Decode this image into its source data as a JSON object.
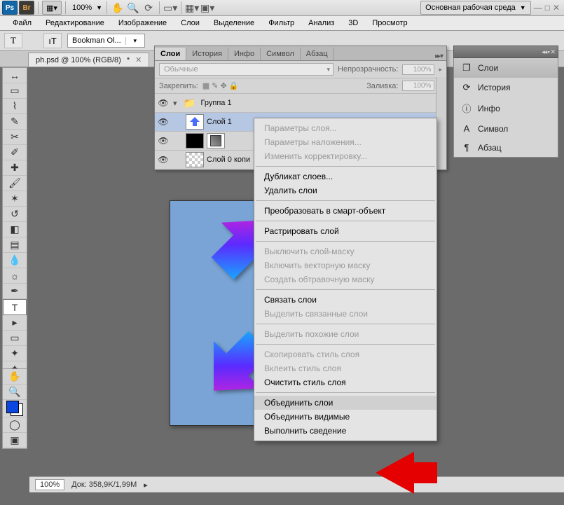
{
  "topbar": {
    "ps": "Ps",
    "br": "Br",
    "zoom": "100%",
    "workspace": "Основная рабочая среда"
  },
  "menubar": [
    "Файл",
    "Редактирование",
    "Изображение",
    "Слои",
    "Выделение",
    "Фильтр",
    "Анализ",
    "3D",
    "Просмотр"
  ],
  "optionsbar": {
    "tool_glyph": "T",
    "orient_glyph": "ıT",
    "font": "Bookman Ol..."
  },
  "doc_tab": {
    "title": "ph.psd @ 100% (RGB/8)",
    "dirty": "*"
  },
  "status": {
    "zoom": "100%",
    "doc": "Док: 358,9K/1,99M"
  },
  "layers_panel": {
    "tabs": [
      "Слои",
      "История",
      "Инфо",
      "Символ",
      "Абзац"
    ],
    "blend_label": "Обычные",
    "opacity_label": "Непрозрачность:",
    "opacity_val": "100%",
    "lock_label": "Закрепить:",
    "fill_label": "Заливка:",
    "fill_val": "100%",
    "layers": [
      {
        "name": "Группа 1",
        "thumb": "folder"
      },
      {
        "name": "Слой 1",
        "thumb": "arrow",
        "sel": true
      },
      {
        "name": "",
        "thumb": "mask"
      },
      {
        "name": "Слой 0 копи",
        "thumb": "chk"
      }
    ]
  },
  "context_menu": {
    "items": [
      {
        "t": "Параметры слоя...",
        "dis": true
      },
      {
        "t": "Параметры наложения...",
        "dis": true
      },
      {
        "t": "Изменить корректировку...",
        "dis": true
      },
      {
        "sep": true
      },
      {
        "t": "Дубликат слоев..."
      },
      {
        "t": "Удалить слои"
      },
      {
        "sep": true
      },
      {
        "t": "Преобразовать в смарт-объект"
      },
      {
        "sep": true
      },
      {
        "t": "Растрировать слой"
      },
      {
        "sep": true
      },
      {
        "t": "Выключить слой-маску",
        "dis": true
      },
      {
        "t": "Включить векторную маску",
        "dis": true
      },
      {
        "t": "Создать обтравочную маску",
        "dis": true
      },
      {
        "sep": true
      },
      {
        "t": "Связать слои"
      },
      {
        "t": "Выделить связанные слои",
        "dis": true
      },
      {
        "sep": true
      },
      {
        "t": "Выделить похожие слои",
        "dis": true
      },
      {
        "sep": true
      },
      {
        "t": "Скопировать стиль слоя",
        "dis": true
      },
      {
        "t": "Вклеить стиль слоя",
        "dis": true
      },
      {
        "t": "Очистить стиль слоя"
      },
      {
        "sep": true
      },
      {
        "t": "Объединить слои",
        "hl": true
      },
      {
        "t": "Объединить видимые"
      },
      {
        "t": "Выполнить сведение"
      }
    ]
  },
  "flyout": [
    {
      "icon": "❐",
      "label": "Слои",
      "active": true
    },
    {
      "icon": "⟳",
      "label": "История"
    },
    {
      "icon": "ⓘ",
      "label": "Инфо"
    },
    {
      "icon": "A",
      "label": "Символ"
    },
    {
      "icon": "¶",
      "label": "Абзац"
    }
  ]
}
